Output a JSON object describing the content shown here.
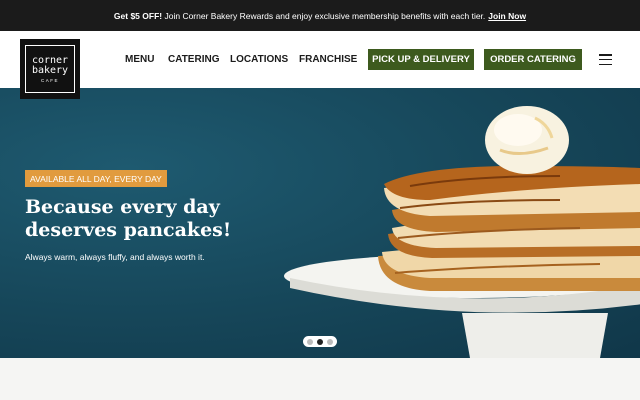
{
  "promo": {
    "bold": "Get $5 OFF!",
    "text": "Join Corner Bakery Rewards and enjoy exclusive membership benefits with each tier.",
    "link": "Join Now"
  },
  "logo": {
    "line1": "corner",
    "line2": "bakery",
    "line3": "CAFE"
  },
  "nav": {
    "items": [
      "MENU",
      "CATERING",
      "LOCATIONS",
      "FRANCHISE"
    ],
    "pickup_button": "PICK UP & DELIVERY",
    "order_button": "ORDER CATERING",
    "menu_icon": "hamburger-menu-icon"
  },
  "hero": {
    "badge": "AVAILABLE ALL DAY, EVERY DAY",
    "headline": "Because every day deserves pancakes!",
    "subtext": "Always warm, always fluffy, and always worth it.",
    "slides_total": 3,
    "active_slide": 2,
    "image": "pancake-stack-with-butter-and-syrup"
  },
  "colors": {
    "promo_bar": "#1b1b1b",
    "button_green": "#3d5a1e",
    "hero_bg": "#164659",
    "badge_orange": "#e19b3e"
  }
}
